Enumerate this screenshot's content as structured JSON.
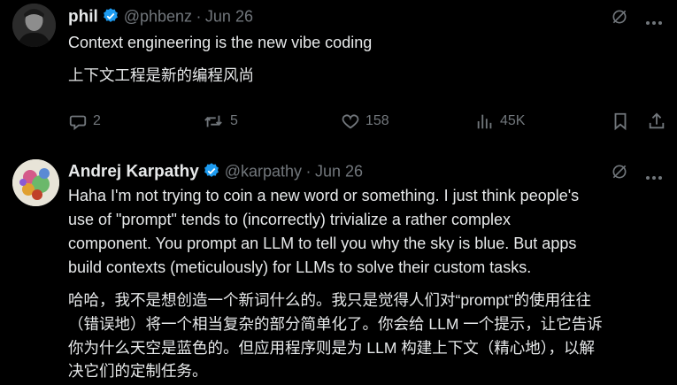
{
  "tweet1": {
    "name": "phil",
    "handle": "@phbenz",
    "sep": "·",
    "date": "Jun 26",
    "text": "Context engineering is the new vibe coding",
    "translation": "上下文工程是新的编程风尚",
    "actions": {
      "reply_count": "2",
      "retweet_count": "5",
      "like_count": "158",
      "views_count": "45K"
    }
  },
  "tweet2": {
    "name": "Andrej Karpathy",
    "handle": "@karpathy",
    "sep": "·",
    "date": "Jun 26",
    "lines": [
      "Haha I'm not trying to coin a new word or something. I just think people's",
      "use of \"prompt\" tends to (incorrectly) trivialize a rather complex",
      "component. You prompt an LLM to tell you why the sky is blue. But apps",
      "build contexts (meticulously) for LLMs to solve their custom tasks."
    ],
    "translation_lines": [
      "哈哈，我不是想创造一个新词什么的。我只是觉得人们对“prompt”的使用往往",
      "（错误地）将一个相当复杂的部分简单化了。你会给 LLM 一个提示，让它告诉",
      "你为什么天空是蓝色的。但应用程序则是为 LLM 构建上下文（精心地），以解",
      "决它们的定制任务。"
    ]
  },
  "icons": {
    "verified": "verified-badge-icon",
    "grok": "grok-icon",
    "more": "more-icon",
    "reply": "reply-icon",
    "retweet": "retweet-icon",
    "like": "like-icon",
    "views": "views-icon",
    "bookmark": "bookmark-icon",
    "share": "share-icon"
  },
  "colors": {
    "background": "#000000",
    "text": "#e7e9ea",
    "muted": "#71767b",
    "verified": "#1d9bf0"
  }
}
